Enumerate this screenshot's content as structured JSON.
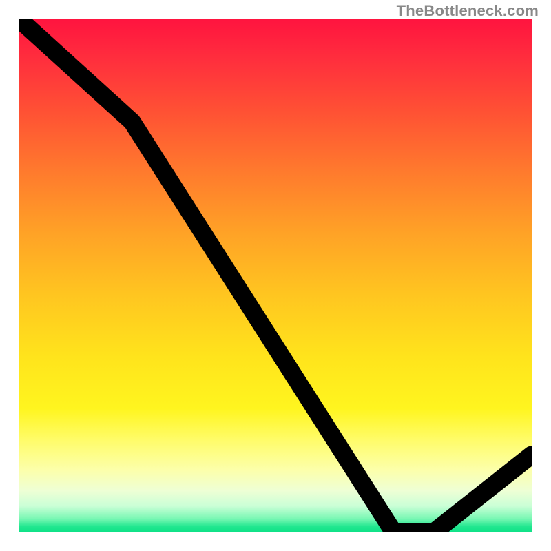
{
  "attribution": "TheBottleneck.com",
  "chart_data": {
    "type": "line",
    "title": "",
    "xlabel": "",
    "ylabel": "",
    "xlim": [
      0,
      100
    ],
    "ylim": [
      0,
      100
    ],
    "x": [
      0,
      22,
      73,
      81,
      100
    ],
    "values": [
      100,
      80,
      0,
      0,
      15
    ],
    "gradient_stops": [
      {
        "pos": 0,
        "color": "#ff143f"
      },
      {
        "pos": 0.08,
        "color": "#ff2f3d"
      },
      {
        "pos": 0.18,
        "color": "#ff5134"
      },
      {
        "pos": 0.3,
        "color": "#ff7b2d"
      },
      {
        "pos": 0.42,
        "color": "#ffa326"
      },
      {
        "pos": 0.54,
        "color": "#ffc620"
      },
      {
        "pos": 0.66,
        "color": "#ffe41c"
      },
      {
        "pos": 0.76,
        "color": "#fff51f"
      },
      {
        "pos": 0.82,
        "color": "#fffc68"
      },
      {
        "pos": 0.88,
        "color": "#fcffab"
      },
      {
        "pos": 0.92,
        "color": "#eeffd5"
      },
      {
        "pos": 0.95,
        "color": "#caffd6"
      },
      {
        "pos": 0.975,
        "color": "#77f7b3"
      },
      {
        "pos": 0.99,
        "color": "#21e78f"
      },
      {
        "pos": 1.0,
        "color": "#0fe288"
      }
    ],
    "optimum_range_x": [
      71,
      83
    ]
  }
}
